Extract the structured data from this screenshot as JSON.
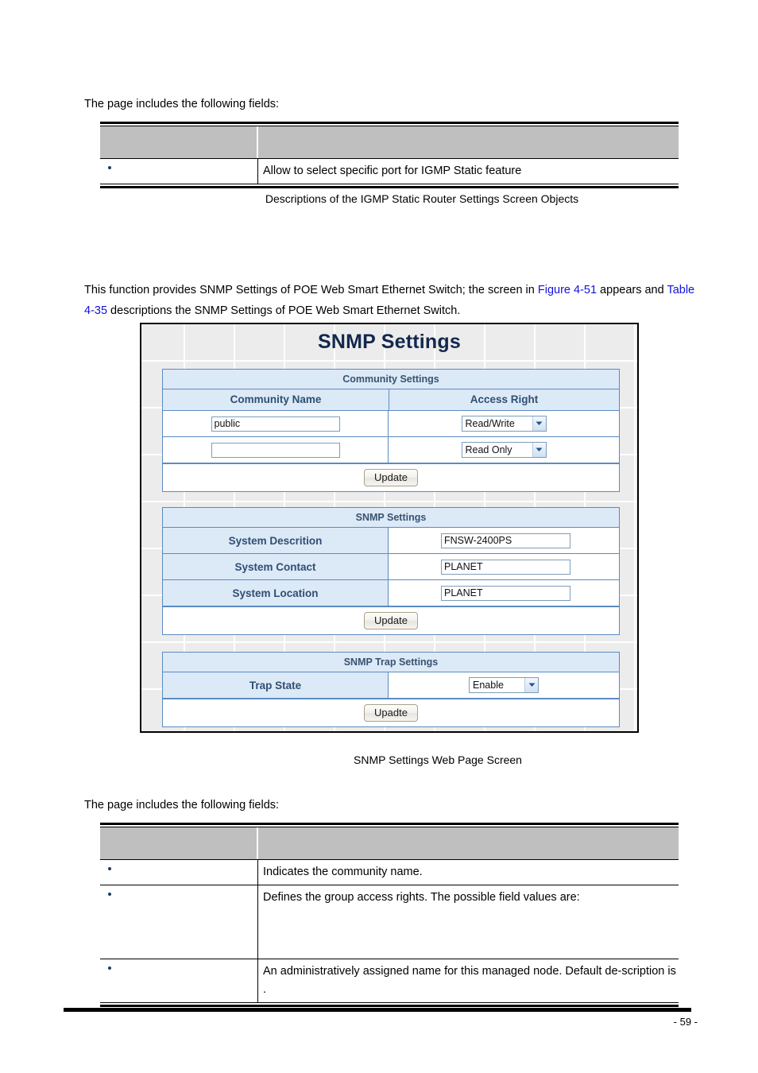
{
  "document": {
    "page_number": "- 59 -"
  },
  "section_igmp": {
    "intro": "The page includes the following fields:",
    "table": {
      "rows": [
        {
          "object": "",
          "description": "Allow to select specific port for IGMP Static feature"
        }
      ]
    },
    "caption": "Descriptions of the IGMP Static Router Settings Screen Objects"
  },
  "section_snmp": {
    "paragraph": {
      "part1": "This function provides SNMP Settings of POE Web Smart Ethernet Switch; the screen in ",
      "link1": "Figure 4-51",
      "part2": " appears and ",
      "link2": "Table 4-35",
      "part3": " descriptions the SNMP Settings of POE Web Smart Ethernet Switch."
    },
    "caption": "SNMP Settings Web Page Screen",
    "intro": "The page includes the following fields:",
    "table": {
      "rows": [
        {
          "object": "",
          "description": "Indicates the community name."
        },
        {
          "object": "",
          "description": "Defines the group access rights. The possible field values are:"
        },
        {
          "object": "",
          "description": "An administratively assigned name for this managed node. Default de-scription is                    ."
        }
      ]
    }
  },
  "screenshot": {
    "title": "SNMP Settings",
    "community_panel": {
      "title": "Community Settings",
      "columns": {
        "name": "Community Name",
        "access": "Access Right"
      },
      "rows": [
        {
          "community_name": "public",
          "access_right": "Read/Write"
        },
        {
          "community_name": "",
          "access_right": "Read Only"
        }
      ],
      "update_label": "Update"
    },
    "snmp_panel": {
      "title": "SNMP Settings",
      "fields": [
        {
          "label": "System Descrition",
          "value": "FNSW-2400PS"
        },
        {
          "label": "System Contact",
          "value": "PLANET"
        },
        {
          "label": "System Location",
          "value": "PLANET"
        }
      ],
      "update_label": "Update"
    },
    "trap_panel": {
      "title": "SNMP Trap Settings",
      "field": {
        "label": "Trap State",
        "value": "Enable"
      },
      "update_label": "Upadte"
    }
  },
  "colors": {
    "panel_header_bg": "#dce9f7",
    "panel_border": "#5b8bc0",
    "title_text": "#12284c",
    "link": "#1111dd",
    "table_header_bg": "#bfbfbf"
  }
}
